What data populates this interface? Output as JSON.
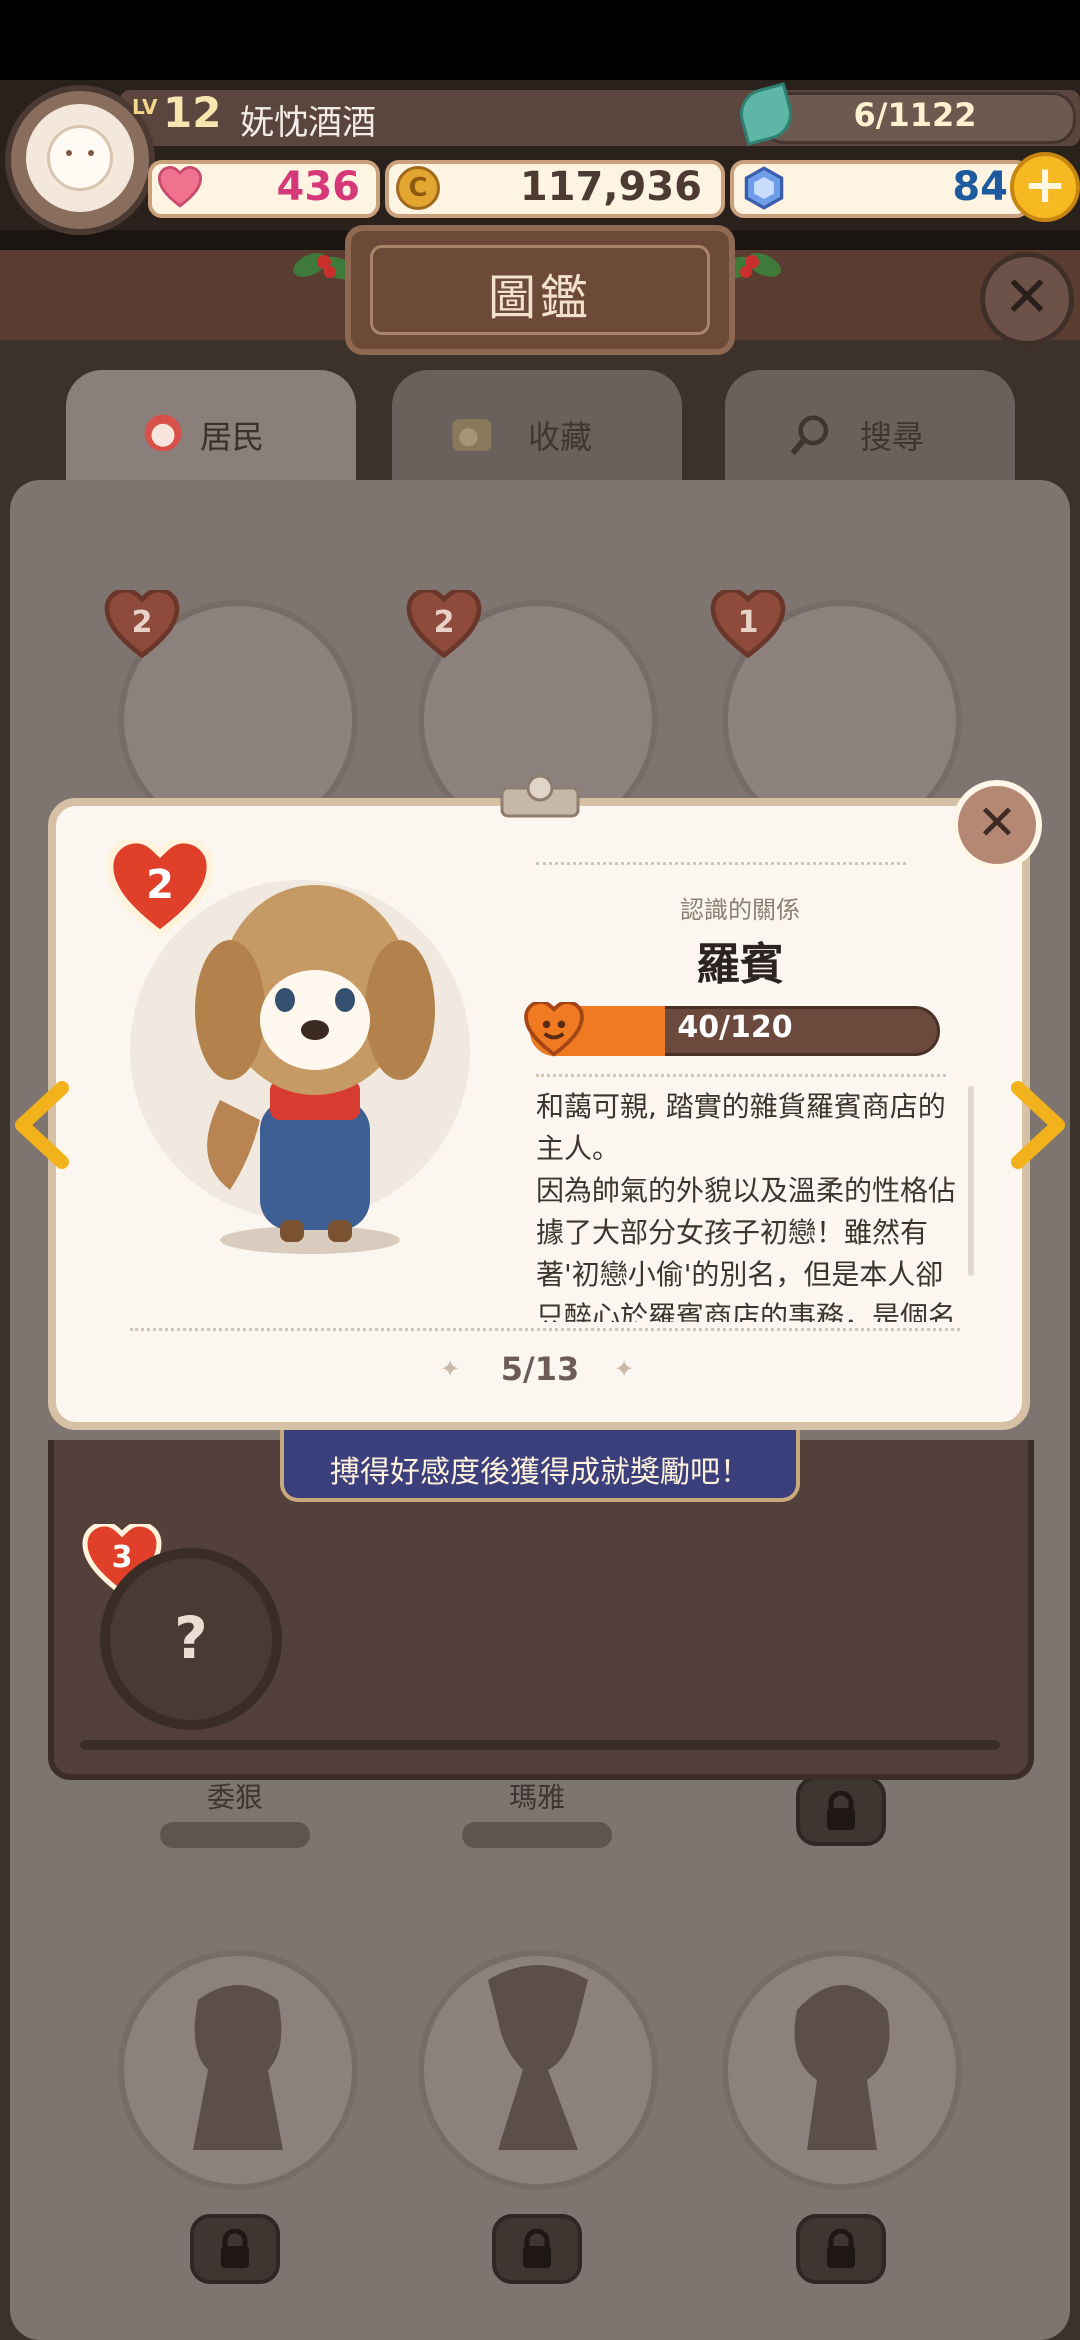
{
  "header": {
    "level_label": "LV",
    "level": "12",
    "player_name": "妩忱酒酒",
    "energy": "6/1122",
    "hearts": "436",
    "coins": "117,936",
    "gems": "84",
    "plus": "+"
  },
  "title": "圖鑑",
  "close_glyph": "✕",
  "tabs": [
    {
      "label": "居民",
      "icon": "resident-icon",
      "active": true
    },
    {
      "label": "收藏",
      "icon": "collection-icon",
      "active": false
    },
    {
      "label": "搜尋",
      "icon": "search-icon",
      "active": false
    }
  ],
  "residents_top": [
    {
      "hearts": "2"
    },
    {
      "hearts": "2"
    },
    {
      "hearts": "1"
    }
  ],
  "residents_mid": [
    {
      "name": "委狠",
      "locked": false
    },
    {
      "name": "瑪雅",
      "locked": false
    },
    {
      "name": "",
      "locked": true
    }
  ],
  "detail": {
    "heart_level": "2",
    "relation_label": "認識的關係",
    "name": "羅賓",
    "affection": "40/120",
    "affection_fraction": 0.33,
    "description": [
      "和藹可親, 踏實的雜貨羅賓商店的主人。",
      "因為帥氣的外貌以及溫柔的性格佔據了大部分女孩子初戀！雖然有著'初戀小偷'的別名，但是本人卻只醉心於羅賓商店的事務，是個名副其"
    ],
    "pager": "5/13"
  },
  "banner": "搏得好感度後獲得成就獎勵吧！",
  "reward": {
    "hearts": "3",
    "mystery": "?"
  },
  "colors": {
    "accent_orange": "#f07a22",
    "heart_red": "#e0402a",
    "banner_blue": "#3b3f7c"
  }
}
